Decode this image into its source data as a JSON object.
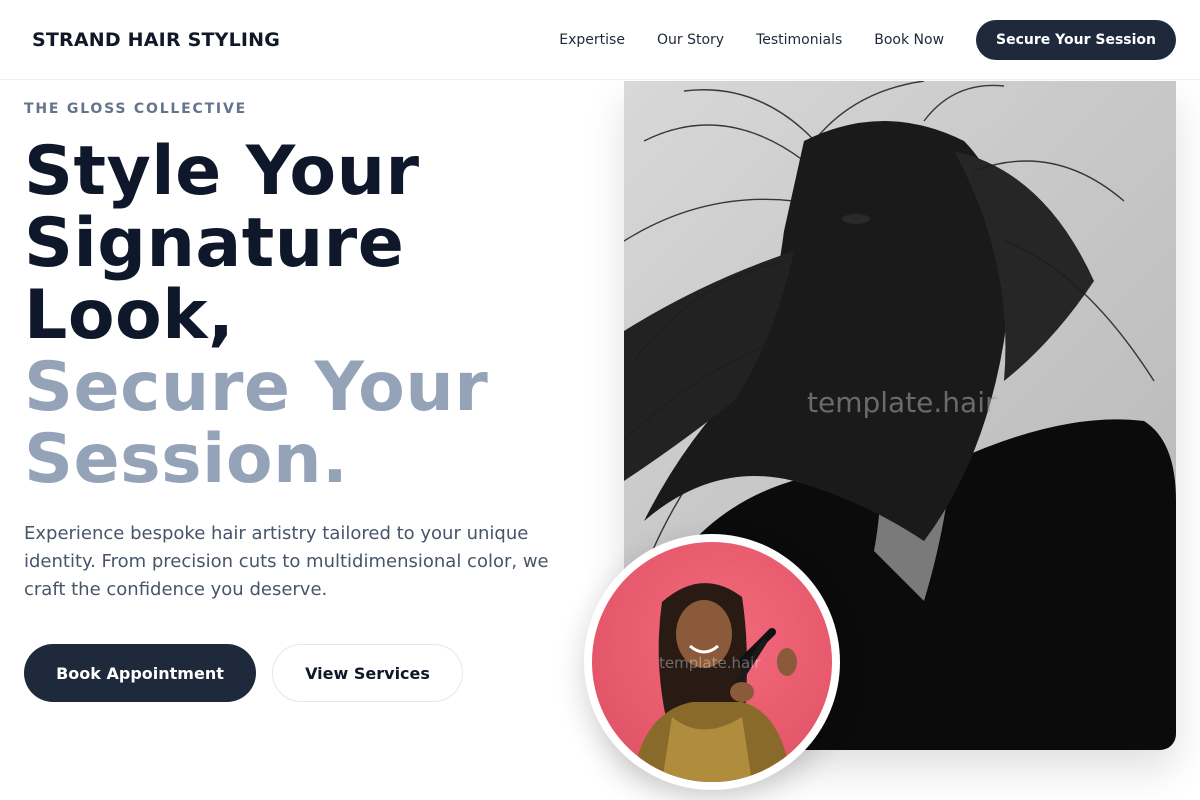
{
  "header": {
    "brand": "STRAND HAIR STYLING",
    "nav": [
      "Expertise",
      "Our Story",
      "Testimonials",
      "Book Now"
    ],
    "cta": "Secure Your Session"
  },
  "hero": {
    "eyebrow": "THE GLOSS COLLECTIVE",
    "headline_dark": [
      "Style Your",
      "Signature",
      "Look,"
    ],
    "headline_light": [
      "Secure Your",
      "Session."
    ],
    "lead": "Experience bespoke hair artistry tailored to your unique identity. From precision cuts to multidimensional color, we craft the confidence you deserve.",
    "primary_button": "Book Appointment",
    "secondary_button": "View Services"
  },
  "images": {
    "hero_watermark": "template.hair",
    "inset_watermark": "template.hair"
  },
  "colors": {
    "primary": "#1e293b",
    "headline_dark": "#0f172a",
    "headline_light": "#94a3b8",
    "inset_bg": "#e85a6d"
  }
}
